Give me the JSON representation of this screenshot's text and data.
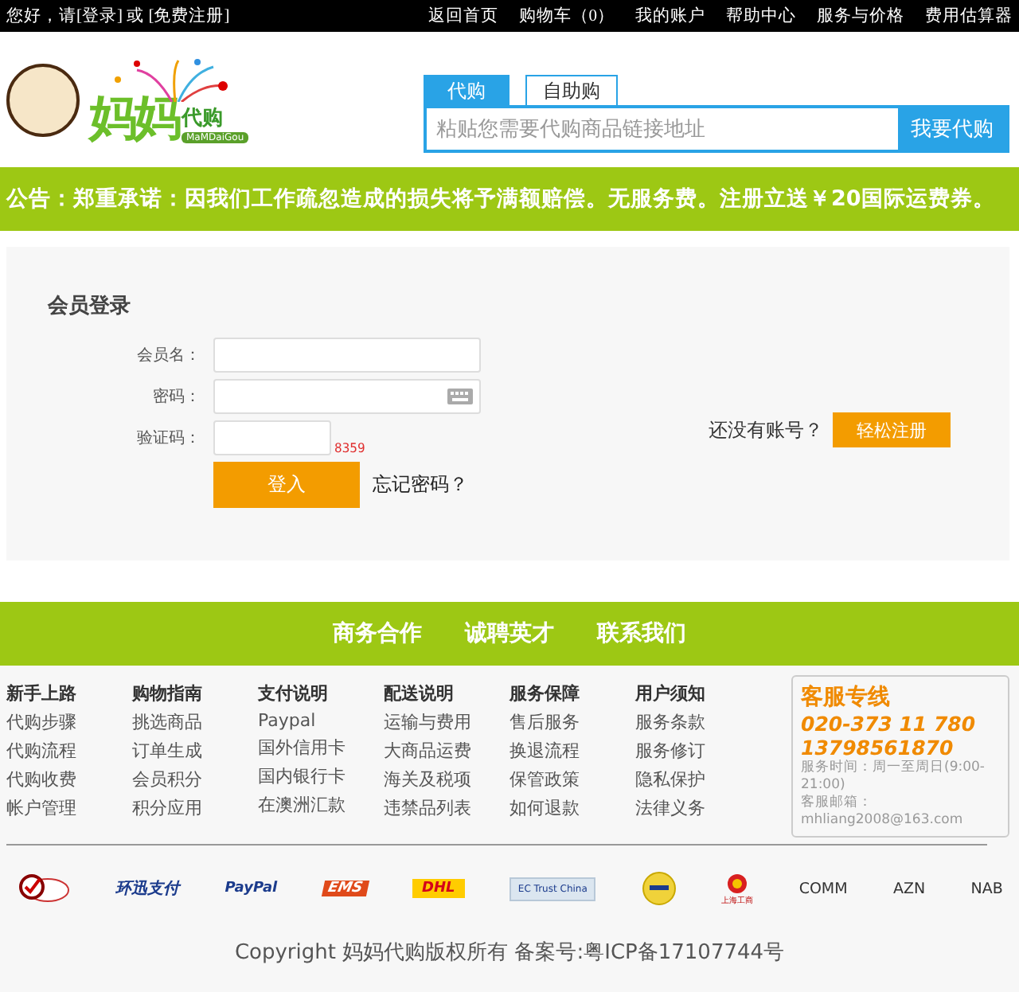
{
  "top_bar": {
    "greeting": "您好，请[登录] 或 [免费注册]",
    "links": [
      "返回首页",
      "购物车（0）",
      "我的账户",
      "帮助中心",
      "服务与价格",
      "费用估算器"
    ]
  },
  "logo": {
    "title": "妈妈",
    "subtitle": "代购",
    "tagline": "MaMDaiGou"
  },
  "search": {
    "tabs": [
      {
        "label": "代购",
        "selected": true
      },
      {
        "label": "自助购",
        "selected": false
      }
    ],
    "placeholder": "粘贴您需要代购商品链接地址",
    "button": "我要代购"
  },
  "notice": "公告：郑重承诺：因我们工作疏忽造成的损失将予满额赔偿。无服务费。注册立送￥20国际运费券。",
  "login": {
    "title": "会员登录",
    "fields": [
      {
        "label": "会员名：",
        "kind": "text"
      },
      {
        "label": "密码：",
        "kind": "password"
      },
      {
        "label": "验证码：",
        "kind": "captcha",
        "captcha": "8359"
      }
    ],
    "submit": "登入",
    "forgot": "忘记密码？",
    "no_account": "还没有账号？",
    "register": "轻松注册"
  },
  "nav": [
    "商务合作",
    "诚聘英才",
    "联系我们"
  ],
  "footer": {
    "columns": [
      {
        "title": "新手上路",
        "links": [
          "代购步骤",
          "代购流程",
          "代购收费",
          "帐户管理"
        ]
      },
      {
        "title": "购物指南",
        "links": [
          "挑选商品",
          "订单生成",
          "会员积分",
          "积分应用"
        ]
      },
      {
        "title": "支付说明",
        "links": [
          "Paypal",
          "国外信用卡",
          "国内银行卡",
          "在澳洲汇款"
        ]
      },
      {
        "title": "配送说明",
        "links": [
          "运输与费用",
          "大商品运费",
          "海关及税项",
          "违禁品列表"
        ]
      },
      {
        "title": "服务保障",
        "links": [
          "售后服务",
          "换退流程",
          "保管政策",
          "如何退款"
        ]
      },
      {
        "title": "用户须知",
        "links": [
          "服务条款",
          "服务修订",
          "隐私保护",
          "法律义务"
        ]
      }
    ],
    "contact": {
      "title": "客服专线",
      "phones": [
        "020-373 11 780",
        "13798561870"
      ],
      "hours": "服务时间：周一至周日(9:00-21:00)",
      "email": "客服邮箱：mhliang2008@163.com"
    },
    "partners": [
      {
        "kind": "seal"
      },
      {
        "kind": "ips",
        "label": "环迅支付"
      },
      {
        "kind": "paypal",
        "label": "PayPal"
      },
      {
        "kind": "ems",
        "label": "EMS"
      },
      {
        "kind": "dhl",
        "label": "DHL"
      },
      {
        "kind": "ectrust",
        "label": "EC Trust China"
      },
      {
        "kind": "paypal-seal"
      },
      {
        "kind": "emblem",
        "label": "上海工商"
      },
      {
        "kind": "text",
        "label": "COMM"
      },
      {
        "kind": "text",
        "label": "AZN"
      },
      {
        "kind": "text",
        "label": "NAB"
      }
    ],
    "copyright": "Copyright 妈妈代购版权所有 备案号:粤ICP备17107744号"
  }
}
